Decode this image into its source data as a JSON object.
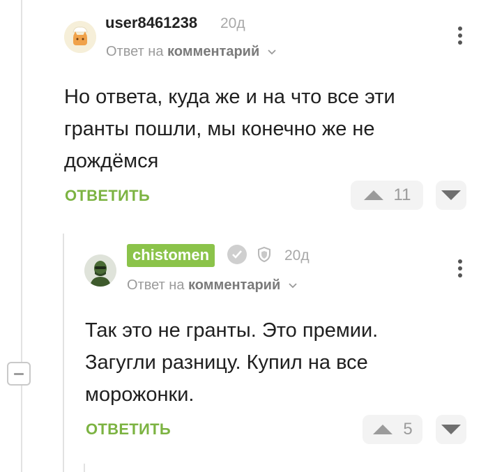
{
  "comment1": {
    "username": "user8461238",
    "time": "20д",
    "reply_prefix": "Ответ на",
    "reply_target": "комментарий",
    "text_lines": [
      "Но ответа, куда же и на что все эти",
      "гранты пошли, мы конечно же не",
      "дождёмся"
    ],
    "reply_label": "ОТВЕТИТЬ",
    "votes": "11"
  },
  "comment2": {
    "username": "chistomen",
    "time": "20д",
    "reply_prefix": "Ответ на",
    "reply_target": "комментарий",
    "text_lines": [
      "Так это не гранты. Это премии.",
      "Загугли разницу. Купил на все",
      "морожонки."
    ],
    "reply_label": "ОТВЕТИТЬ",
    "votes": "5"
  },
  "colors": {
    "accent_green": "#8bc34a",
    "reply_green": "#7cb342"
  },
  "icons": [
    "avatar-cat-chef",
    "avatar-soldier",
    "verified-check-icon",
    "shield-icon",
    "chevron-down-icon",
    "more-vertical-icon",
    "arrow-up-icon",
    "arrow-down-icon",
    "collapse-minus-icon"
  ]
}
